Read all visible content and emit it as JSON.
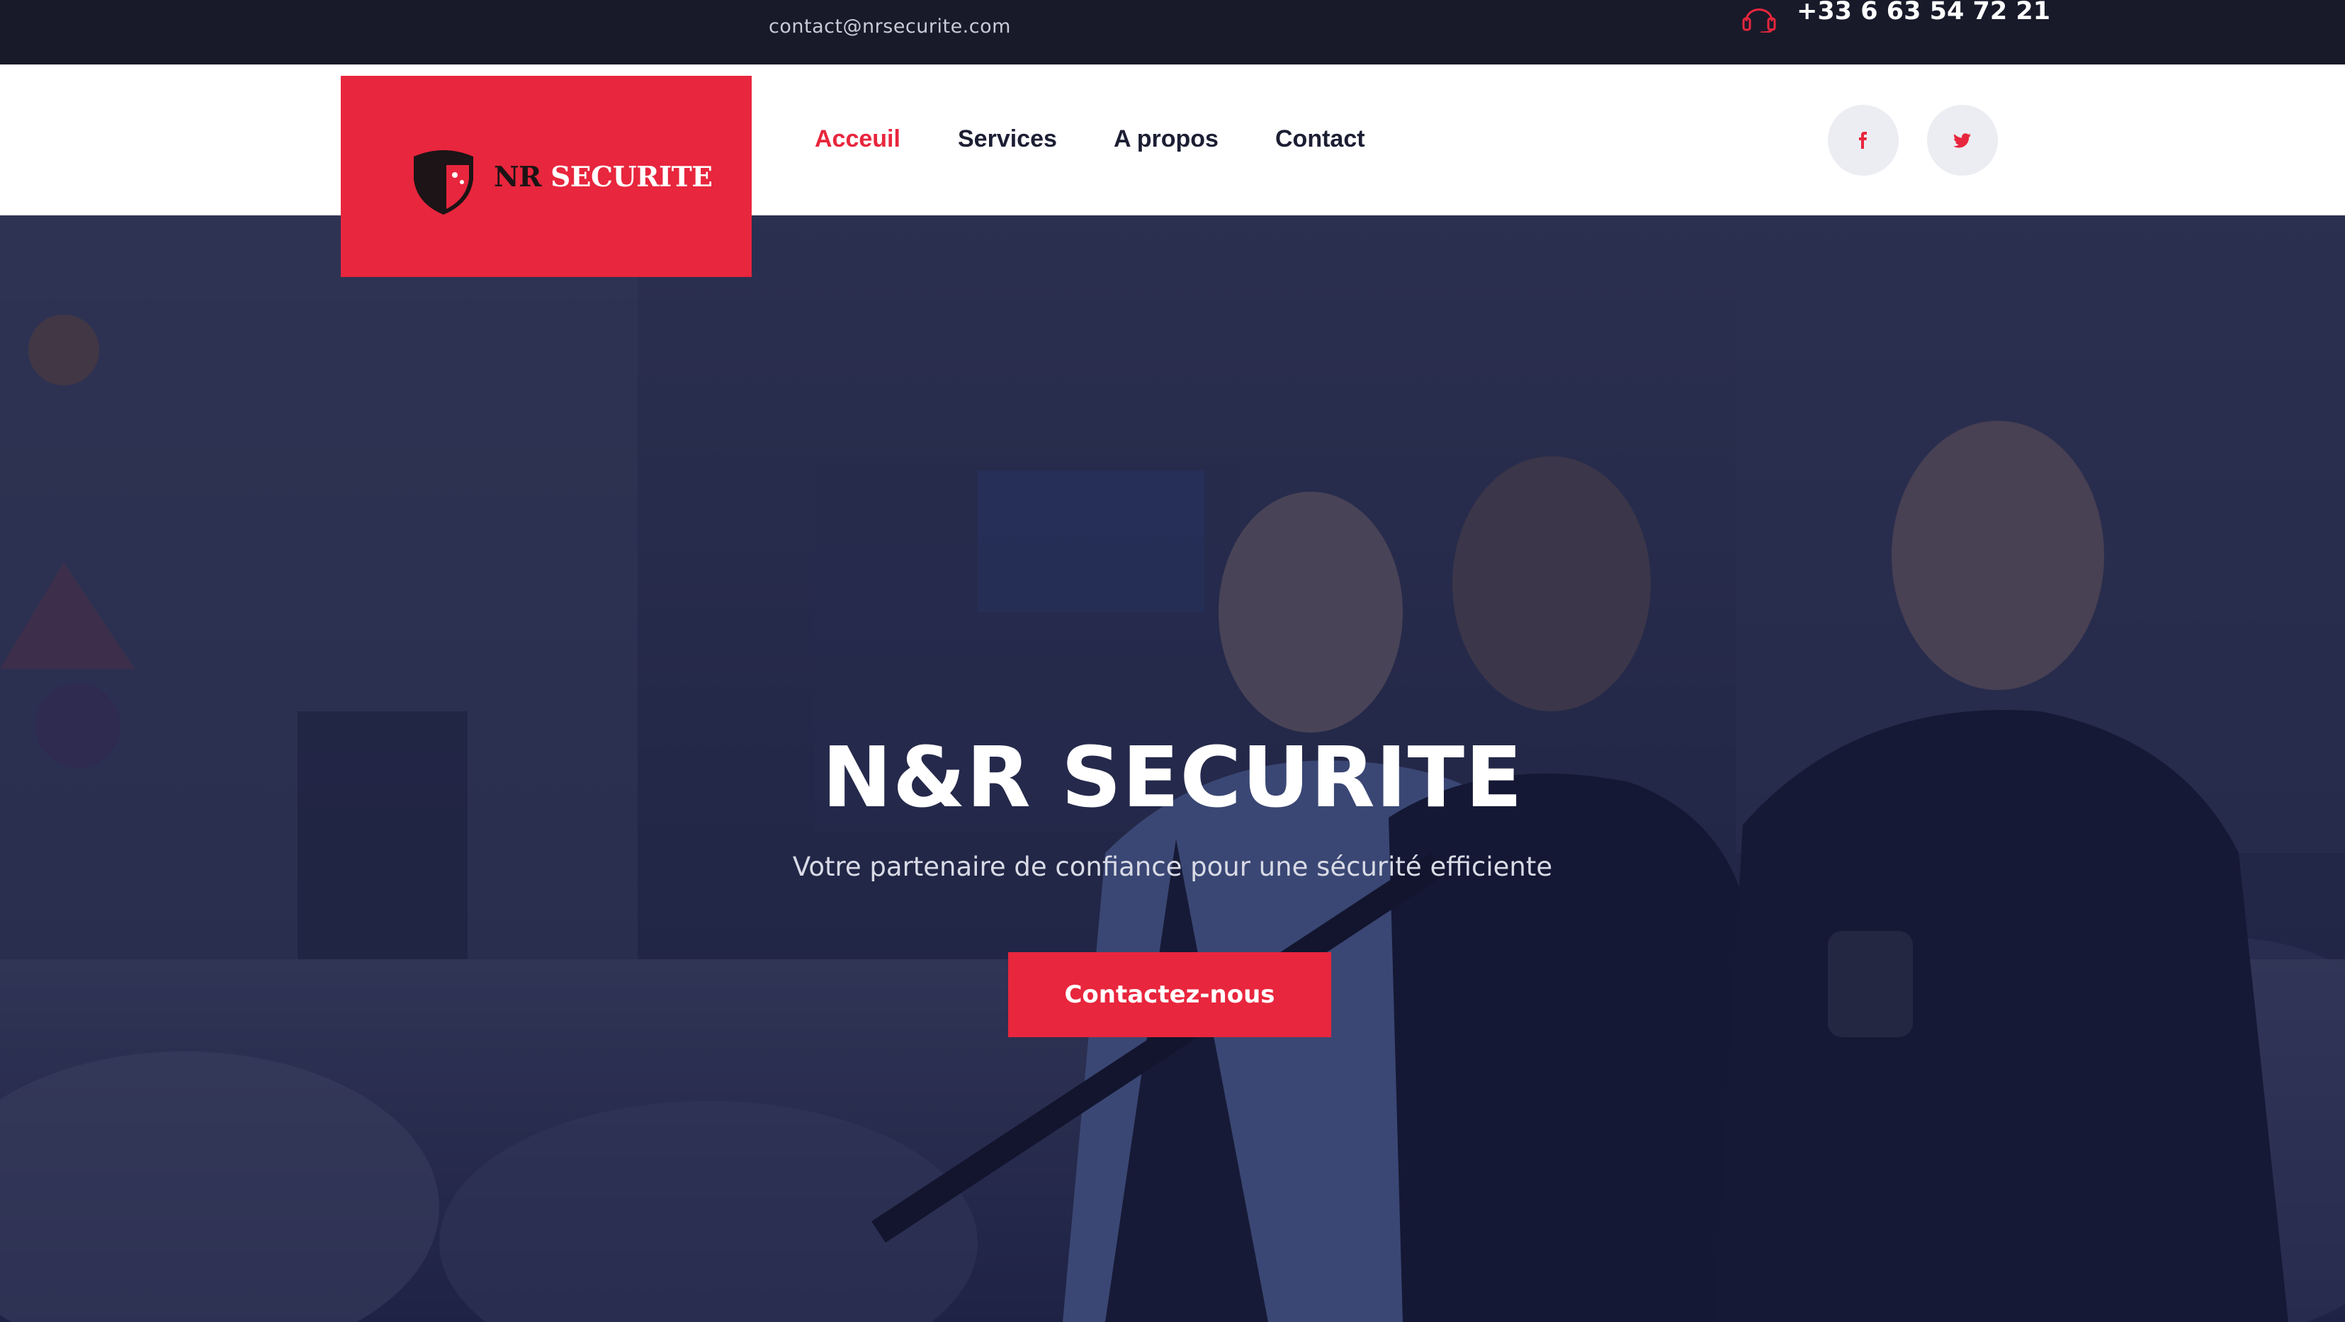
{
  "topbar": {
    "email": "contact@nrsecurite.com",
    "phone": "+33 6 63 54 72 21",
    "phone_icon": "headset-icon"
  },
  "brand": {
    "logo_prefix": "NR",
    "logo_suffix": "SECURITE",
    "logo_icon": "shield-icon",
    "color": "#e8263d"
  },
  "nav": {
    "items": [
      {
        "label": "Acceuil",
        "active": true
      },
      {
        "label": "Services",
        "active": false
      },
      {
        "label": "A propos",
        "active": false
      },
      {
        "label": "Contact",
        "active": false
      }
    ]
  },
  "social": {
    "facebook_icon": "facebook-icon",
    "twitter_icon": "twitter-icon"
  },
  "hero": {
    "title": "N&R SECURITE",
    "subtitle": "Votre partenaire de confiance pour une sécurité efficiente",
    "cta_label": "Contactez-nous"
  },
  "colors": {
    "accent": "#e8263d",
    "dark": "#181a2a",
    "nav_text": "#1c1e33"
  }
}
